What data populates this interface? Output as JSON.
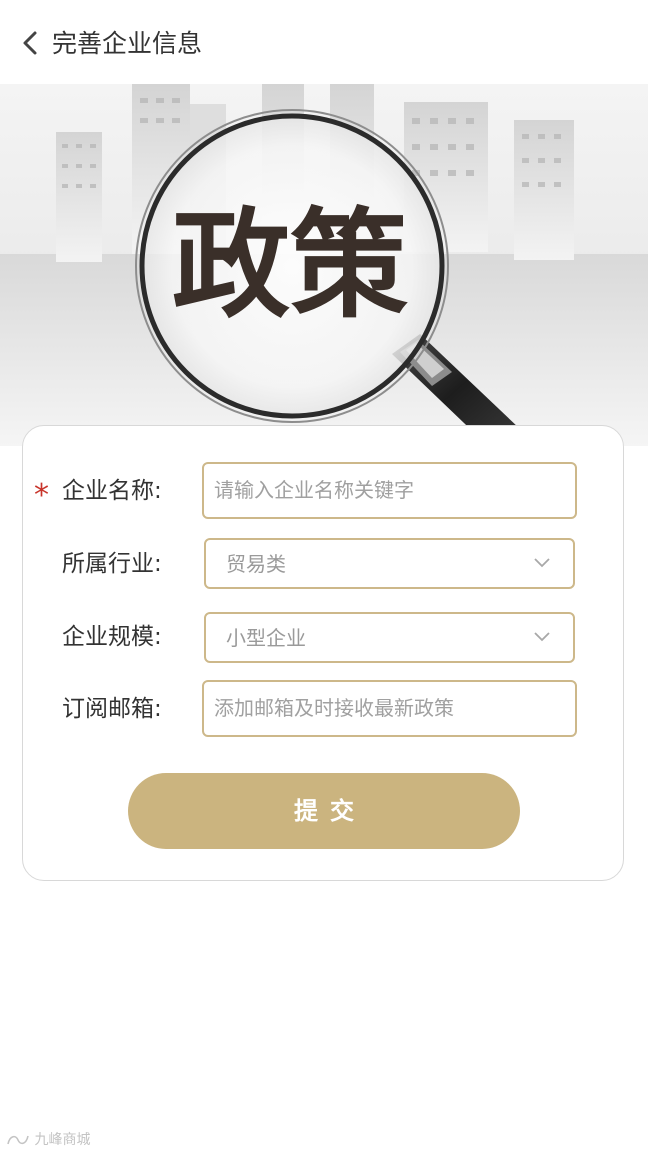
{
  "header": {
    "title": "完善企业信息"
  },
  "banner": {
    "headline": "政策"
  },
  "form": {
    "company_name": {
      "label": "企业名称:",
      "placeholder": "请输入企业名称关键字",
      "required": true
    },
    "industry": {
      "label": "所属行业:",
      "value": "贸易类"
    },
    "scale": {
      "label": "企业规模:",
      "value": "小型企业"
    },
    "email": {
      "label": "订阅邮箱:",
      "placeholder": "添加邮箱及时接收最新政策"
    },
    "submit_label": "提交",
    "required_mark": "*"
  },
  "watermark": {
    "text": "九峰商城"
  },
  "colors": {
    "accent": "#cbb47f",
    "field_border": "#cdb88a",
    "required": "#c8342a"
  }
}
